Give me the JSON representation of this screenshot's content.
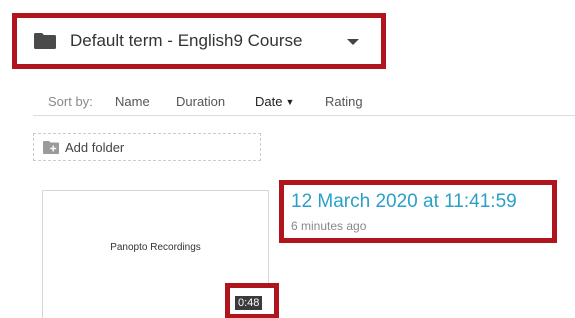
{
  "folder_dropdown": {
    "label": "Default term - English9 Course",
    "icon": "folder-icon"
  },
  "sort_bar": {
    "label": "Sort by:",
    "options": [
      "Name",
      "Duration",
      "Date",
      "Rating"
    ],
    "active": "Date",
    "active_direction_icon": "triangle-down-icon"
  },
  "add_folder": {
    "label": "Add folder",
    "icon": "add-folder-icon"
  },
  "session": {
    "thumbnail_title": "Panopto Recordings",
    "duration": "0:48",
    "date": "12 March 2020 at 11:41:59",
    "relative_time": "6 minutes ago"
  },
  "colors": {
    "highlight_border": "#b0141c",
    "link": "#2aa0c8"
  }
}
